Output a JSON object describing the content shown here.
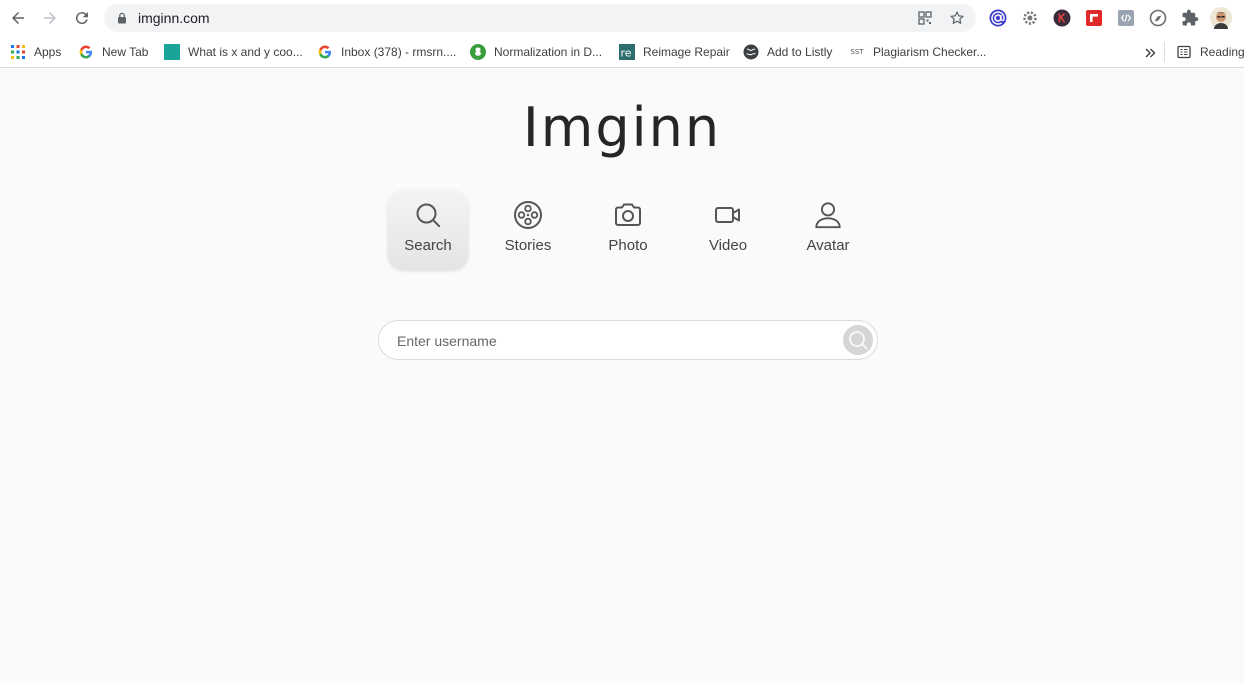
{
  "browser": {
    "url": "imginn.com",
    "bookmarks": [
      {
        "label": "Apps",
        "icon": "apps-grid-icon"
      },
      {
        "label": "New Tab",
        "icon": "google-icon"
      },
      {
        "label": "What is x and y coo...",
        "icon": "teal-square-icon"
      },
      {
        "label": "Inbox (378) - rmsrn....",
        "icon": "google-icon"
      },
      {
        "label": "Normalization in D...",
        "icon": "green-circle-icon"
      },
      {
        "label": "Reimage Repair",
        "icon": "reimage-icon"
      },
      {
        "label": "Add to Listly",
        "icon": "globe-icon"
      },
      {
        "label": "Plagiarism Checker...",
        "icon": "sst-icon"
      },
      {
        "label": "Reading list",
        "icon": "reading-list-icon"
      }
    ],
    "sst_text": "SST"
  },
  "page": {
    "logo": "Imginn",
    "tabs": [
      {
        "label": "Search",
        "icon": "search-icon",
        "active": true
      },
      {
        "label": "Stories",
        "icon": "film-reel-icon",
        "active": false
      },
      {
        "label": "Photo",
        "icon": "camera-icon",
        "active": false
      },
      {
        "label": "Video",
        "icon": "video-camera-icon",
        "active": false
      },
      {
        "label": "Avatar",
        "icon": "user-icon",
        "active": false
      }
    ],
    "search": {
      "placeholder": "Enter username",
      "value": ""
    }
  }
}
